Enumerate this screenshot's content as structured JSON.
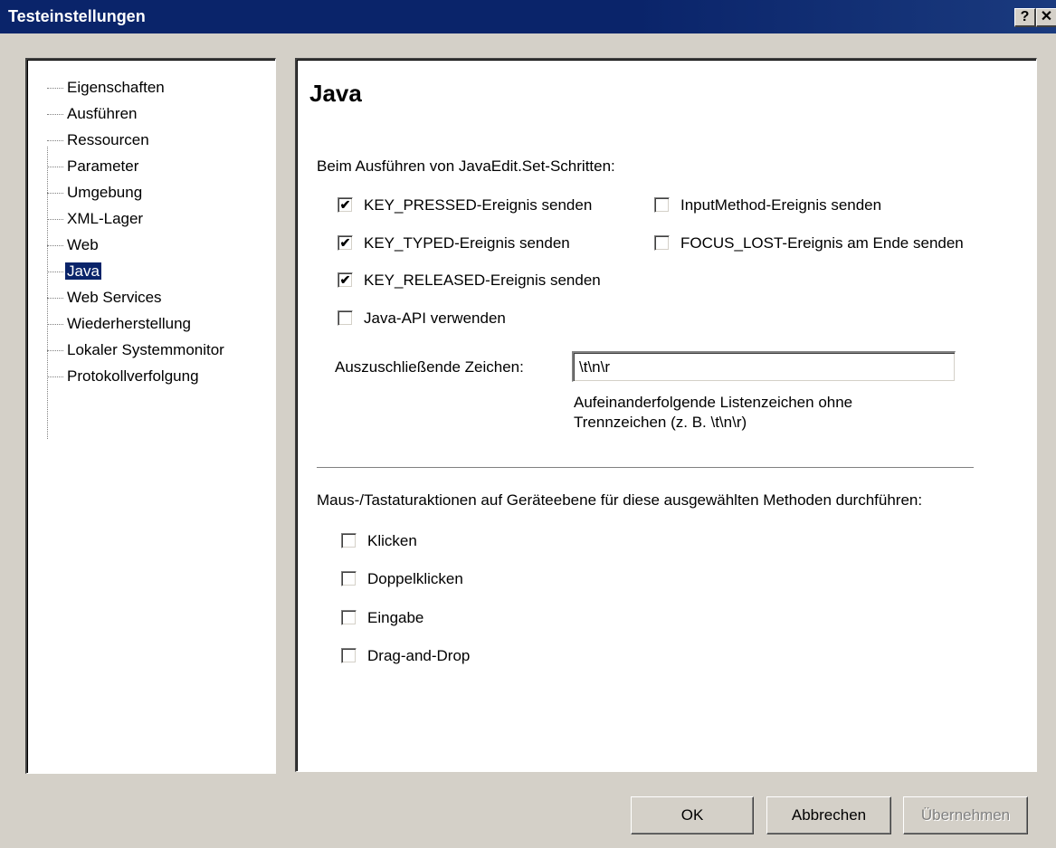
{
  "window": {
    "title": "Testeinstellungen",
    "help_label": "?",
    "close_label": "✕"
  },
  "tree": {
    "items": [
      {
        "label": "Eigenschaften"
      },
      {
        "label": "Ausführen"
      },
      {
        "label": "Ressourcen"
      },
      {
        "label": "Parameter"
      },
      {
        "label": "Umgebung"
      },
      {
        "label": "XML-Lager"
      },
      {
        "label": "Web"
      },
      {
        "label": "Java",
        "selected": true
      },
      {
        "label": "Web Services"
      },
      {
        "label": "Wiederherstellung"
      },
      {
        "label": "Lokaler Systemmonitor"
      },
      {
        "label": "Protokollverfolgung"
      }
    ]
  },
  "page": {
    "title": "Java",
    "section1_label": "Beim Ausführen von JavaEdit.Set-Schritten:",
    "checkboxes": [
      {
        "label": "KEY_PRESSED-Ereignis senden",
        "checked": true
      },
      {
        "label": "InputMethod-Ereignis senden",
        "checked": false
      },
      {
        "label": "KEY_TYPED-Ereignis senden",
        "checked": true
      },
      {
        "label": "FOCUS_LOST-Ereignis am Ende senden",
        "checked": false
      },
      {
        "label": "KEY_RELEASED-Ereignis senden",
        "checked": true
      },
      {
        "label": "Java-API verwenden",
        "checked": false
      }
    ],
    "exclude_label": "Auszuschließende Zeichen:",
    "exclude_value": "\\t\\n\\r",
    "hint_line1": "Aufeinanderfolgende Listenzeichen ohne",
    "hint_line2": "Trennzeichen (z. B. \\t\\n\\r)",
    "section2_label": "Maus-/Tastaturaktionen auf Geräteebene für diese ausgewählten Methoden durchführen:",
    "methods": [
      {
        "label": "Klicken",
        "checked": false
      },
      {
        "label": "Doppelklicken",
        "checked": false
      },
      {
        "label": "Eingabe",
        "checked": false
      },
      {
        "label": "Drag-and-Drop",
        "checked": false
      }
    ]
  },
  "buttons": {
    "ok": "OK",
    "cancel": "Abbrechen",
    "apply": "Übernehmen",
    "apply_enabled": false
  }
}
